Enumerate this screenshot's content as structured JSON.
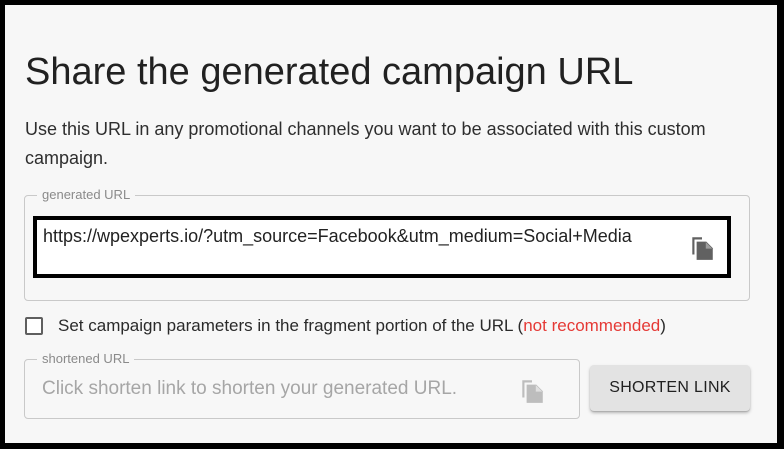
{
  "heading": {
    "title": "Share the generated campaign URL",
    "description": "Use this URL in any promotional channels you want to be associated with this custom campaign."
  },
  "generated_url": {
    "label": "generated URL",
    "value": "https://wpexperts.io/?utm_source=Facebook&utm_medium=Social+Media",
    "copy_icon": "copy-icon"
  },
  "fragment_option": {
    "checked": false,
    "label": "Set campaign parameters in the fragment portion of the URL (",
    "warning": "not recommended",
    "closing": ")"
  },
  "shortened_url": {
    "label": "shortened URL",
    "placeholder": "Click shorten link to shorten your generated URL.",
    "copy_icon": "copy-icon"
  },
  "shorten_button": {
    "label": "SHORTEN LINK"
  },
  "colors": {
    "warning": "#e53935",
    "icon_active": "#616161",
    "icon_disabled": "#bdbdbd",
    "button_bg": "#e3e3e3"
  }
}
